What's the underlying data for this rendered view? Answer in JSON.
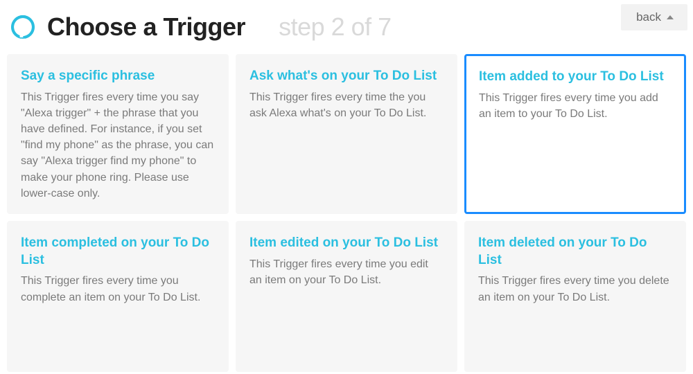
{
  "header": {
    "title": "Choose a Trigger",
    "step": "step 2 of 7",
    "back_label": "back"
  },
  "triggers": [
    {
      "title": "Say a specific phrase",
      "desc": "This Trigger fires every time you say \"Alexa trigger\" + the phrase that you have defined. For instance, if you set \"find my phone\" as the phrase, you can say \"Alexa trigger find my phone\" to make your phone ring. Please use lower-case only.",
      "selected": false
    },
    {
      "title": "Ask what's on your To Do List",
      "desc": "This Trigger fires every time the you ask Alexa what's on your To Do List.",
      "selected": false
    },
    {
      "title": "Item added to your To Do List",
      "desc": "This Trigger fires every time you add an item to your To Do List.",
      "selected": true
    },
    {
      "title": "Item completed on your To Do List",
      "desc": "This Trigger fires every time you complete an item on your To Do List.",
      "selected": false
    },
    {
      "title": "Item edited on your To Do List",
      "desc": "This Trigger fires every time you edit an item on your To Do List.",
      "selected": false
    },
    {
      "title": "Item deleted on your To Do List",
      "desc": "This Trigger fires every time you delete an item on your To Do List.",
      "selected": false
    }
  ]
}
